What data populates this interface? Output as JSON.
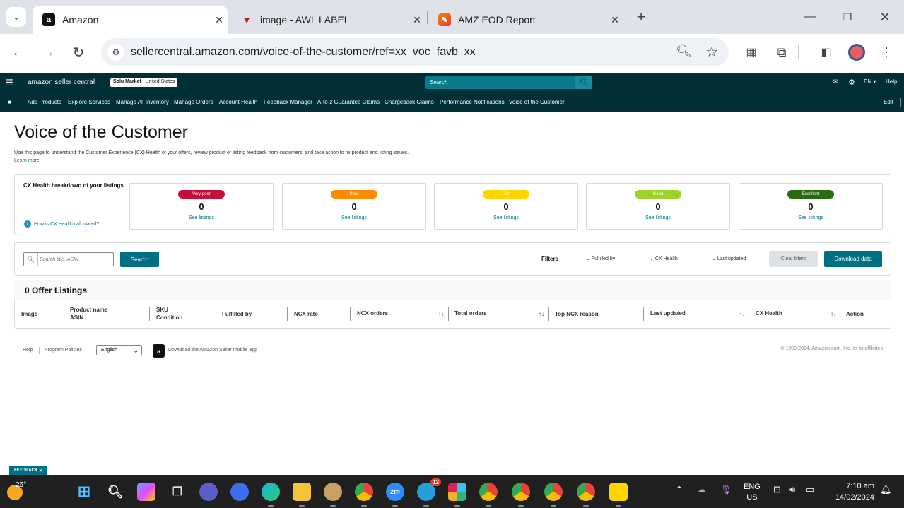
{
  "browser": {
    "tabs": [
      {
        "title": "Amazon",
        "icon": "amazon-icon"
      },
      {
        "title": "image - AWL LABEL",
        "icon": "awl-label-icon"
      },
      {
        "title": "AMZ EOD Report",
        "icon": "report-icon"
      }
    ],
    "url": "sellercentral.amazon.com/voice-of-the-customer/ref=xx_voc_favb_xx"
  },
  "sc_header": {
    "logo": "amazon seller central",
    "store_name": "Solu Market",
    "store_region": "United States",
    "search_placeholder": "Search",
    "language": "EN",
    "help": "Help"
  },
  "nav": {
    "items": [
      "Add Products",
      "Explore Services",
      "Manage All Inventory",
      "Manage Orders",
      "Account Health",
      "Feedback Manager",
      "A-to-z Guarantee Claims",
      "Chargeback Claims",
      "Performance Notifications",
      "Voice of the Customer"
    ],
    "edit": "Edit"
  },
  "page": {
    "title": "Voice of the Customer",
    "description": "Use this page to understand the Customer Experience (CX) Health of your offers, review product or listing feedback from customers, and take action to fix product and listing issues.",
    "learn_more": "Learn more"
  },
  "cx_health": {
    "label": "CX Health breakdown of your listings",
    "how_link": "How is CX Health calculated?",
    "cards": [
      {
        "label": "Very poor",
        "count": "0",
        "link": "See listings",
        "color": "#c40f3a",
        "text_color": "#ffffff"
      },
      {
        "label": "Poor",
        "count": "0",
        "link": "See listings",
        "color": "#ff8c00",
        "text_color": "#ffffff"
      },
      {
        "label": "Fair",
        "count": "0",
        "link": "See listings",
        "color": "#ffd400",
        "text_color": "#ffffff"
      },
      {
        "label": "Good",
        "count": "0",
        "link": "See listings",
        "color": "#9bd22b",
        "text_color": "#ffffff"
      },
      {
        "label": "Excellent",
        "count": "0",
        "link": "See listings",
        "color": "#2b6b0f",
        "text_color": "#ffffff"
      }
    ]
  },
  "filters": {
    "search_placeholder": "Search title, ASIN",
    "search_button": "Search",
    "label": "Filters",
    "dropdowns": [
      "Fulfilled by",
      "CX Health",
      "Last updated"
    ],
    "clear": "Clear filters",
    "download": "Download data"
  },
  "table": {
    "title": "0 Offer Listings",
    "columns": [
      {
        "line1": "Image",
        "line2": ""
      },
      {
        "line1": "Product name",
        "line2": "ASIN"
      },
      {
        "line1": "SKU",
        "line2": "Condition"
      },
      {
        "line1": "Fulfilled by",
        "line2": ""
      },
      {
        "line1": "NCX rate",
        "line2": ""
      },
      {
        "line1": "NCX orders",
        "line2": ""
      },
      {
        "line1": "Total orders",
        "line2": ""
      },
      {
        "line1": "Top NCX reason",
        "line2": ""
      },
      {
        "line1": "Last updated",
        "line2": ""
      },
      {
        "line1": "CX Health",
        "line2": ""
      },
      {
        "line1": "Action",
        "line2": ""
      }
    ]
  },
  "footer": {
    "help": "Help",
    "policies": "Program Policies",
    "language": "English",
    "app_link": "Download the Amazon Seller mobile app",
    "copyright": "© 1999-2024, Amazon.com, Inc. or its affiliates"
  },
  "feedback": "FEEDBACK",
  "taskbar": {
    "weather_temp": "26°",
    "telegram_badge": "12",
    "lang_line1": "ENG",
    "lang_line2": "US",
    "time": "7:10 am",
    "date": "14/02/2024"
  }
}
